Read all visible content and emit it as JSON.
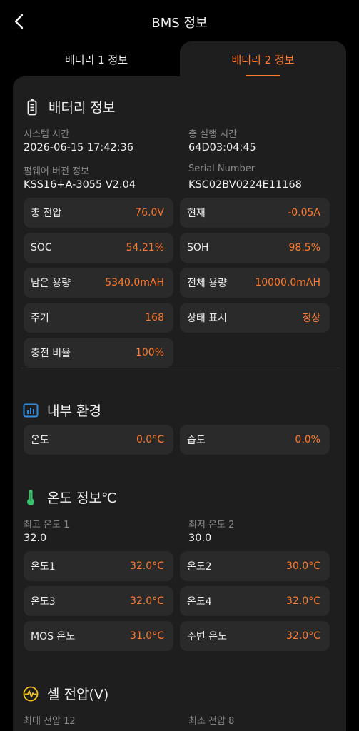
{
  "header": {
    "title": "BMS 정보"
  },
  "tabs": [
    {
      "label": "배터리 1 정보"
    },
    {
      "label": "배터리 2 정보"
    }
  ],
  "battery_info": {
    "title": "배터리 정보",
    "fields": [
      {
        "label": "시스템 시간",
        "value": "2026-06-15 17:42:36"
      },
      {
        "label": "총 실행 시간",
        "value": "64D03:04:45"
      },
      {
        "label": "펌웨어 버전 정보",
        "value": "KSS16+A-3055 V2.04"
      },
      {
        "label": "Serial Number",
        "value": "KSC02BV0224E11168"
      }
    ],
    "cards": [
      {
        "label": "총 전압",
        "value": "76.0V"
      },
      {
        "label": "현재",
        "value": "-0.05A"
      },
      {
        "label": "SOC",
        "value": "54.21%"
      },
      {
        "label": "SOH",
        "value": "98.5%"
      },
      {
        "label": "남은 용량",
        "value": "5340.0mAH"
      },
      {
        "label": "전체 용량",
        "value": "10000.0mAH"
      },
      {
        "label": "주기",
        "value": "168"
      },
      {
        "label": "상태 표시",
        "value": "정상"
      },
      {
        "label": "충전 비율",
        "value": "100%"
      }
    ]
  },
  "internal_env": {
    "title": "내부 환경",
    "cards": [
      {
        "label": "온도",
        "value": "0.0°C"
      },
      {
        "label": "습도",
        "value": "0.0%"
      }
    ]
  },
  "temp_info": {
    "title": "온도 정보℃",
    "fields": [
      {
        "label": "최고 온도 1",
        "value": "32.0"
      },
      {
        "label": "최저 온도 2",
        "value": "30.0"
      }
    ],
    "cards": [
      {
        "label": "온도1",
        "value": "32.0°C"
      },
      {
        "label": "온도2",
        "value": "30.0°C"
      },
      {
        "label": "온도3",
        "value": "32.0°C"
      },
      {
        "label": "온도4",
        "value": "32.0°C"
      },
      {
        "label": "MOS 온도",
        "value": "31.0°C"
      },
      {
        "label": "주변 온도",
        "value": "32.0°C"
      }
    ]
  },
  "cell_voltage": {
    "title": "셀 전압(V)",
    "fields": [
      {
        "label": "최대 전압 12"
      },
      {
        "label": "최소 전압 8"
      }
    ]
  },
  "colors": {
    "accent": "#ff7a2f",
    "panel": "#1e1e1e",
    "card": "#2a2a2a",
    "icon_blue": "#2f8de4",
    "icon_green": "#37c26b",
    "icon_yellow": "#f5c518"
  },
  "icons": [
    "back-arrow-icon",
    "battery-icon",
    "chart-icon",
    "thermometer-icon",
    "pulse-icon"
  ]
}
